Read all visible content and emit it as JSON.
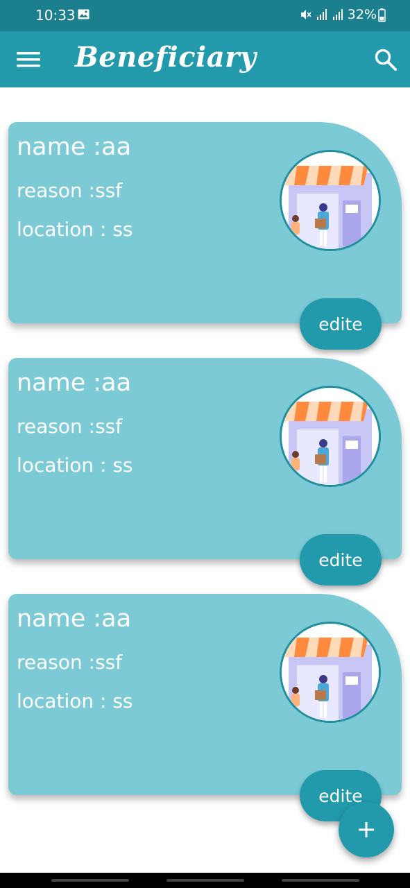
{
  "status_bar": {
    "time": "10:33",
    "battery": "32%"
  },
  "app_bar": {
    "title": "Beneficiary",
    "menu_icon": "hamburger-menu-icon",
    "search_icon": "search-icon",
    "color": "#229aac"
  },
  "cards": [
    {
      "name": "name :aa",
      "reason": "reason :ssf",
      "location": "location : ss",
      "edit_label": "edite"
    },
    {
      "name": "name :aa",
      "reason": "reason :ssf",
      "location": "location : ss",
      "edit_label": "edite"
    },
    {
      "name": "name :aa",
      "reason": "reason :ssf",
      "location": "location : ss",
      "edit_label": "edite"
    }
  ],
  "fab": {
    "label": "+",
    "icon": "plus-icon"
  },
  "colors": {
    "status_bar": "#1b7f8e",
    "app_bar": "#229aac",
    "card": "#7bcad5",
    "button": "#229aac"
  }
}
